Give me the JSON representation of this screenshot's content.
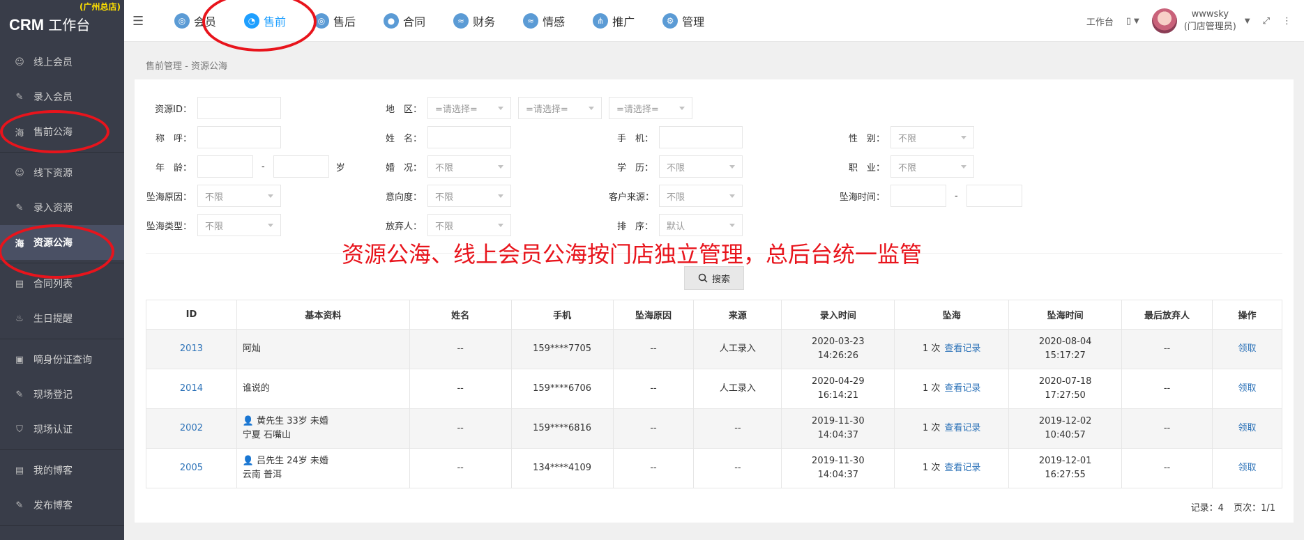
{
  "brand": {
    "title": "CRM",
    "subtitle": "工作台",
    "store": "(广州总店)"
  },
  "sidebar": {
    "groups": [
      [
        {
          "label": "线上会员",
          "icon": "user-icon"
        },
        {
          "label": "录入会员",
          "icon": "edit-icon"
        },
        {
          "label": "售前公海",
          "icon": "sea-icon"
        }
      ],
      [
        {
          "label": "线下资源",
          "icon": "user-group-icon"
        },
        {
          "label": "录入资源",
          "icon": "edit-icon"
        },
        {
          "label": "资源公海",
          "icon": "sea-icon",
          "active": true
        }
      ],
      [
        {
          "label": "合同列表",
          "icon": "list-icon"
        },
        {
          "label": "生日提醒",
          "icon": "cake-icon"
        }
      ],
      [
        {
          "label": "嘀身份证查询",
          "icon": "id-card-icon"
        },
        {
          "label": "现场登记",
          "icon": "edit-icon"
        },
        {
          "label": "现场认证",
          "icon": "shield-icon"
        }
      ],
      [
        {
          "label": "我的博客",
          "icon": "doc-icon"
        },
        {
          "label": "发布博客",
          "icon": "edit-icon"
        }
      ]
    ],
    "sea_glyph": "海"
  },
  "topnav": [
    {
      "label": "会员",
      "glyph": "◎"
    },
    {
      "label": "售前",
      "glyph": "◔",
      "active": true
    },
    {
      "label": "售后",
      "glyph": "◎"
    },
    {
      "label": "合同",
      "glyph": "●"
    },
    {
      "label": "财务",
      "glyph": "≈"
    },
    {
      "label": "情感",
      "glyph": "≈"
    },
    {
      "label": "推广",
      "glyph": "⋔"
    },
    {
      "label": "管理",
      "glyph": "⚙"
    }
  ],
  "topright": {
    "workbench": "工作台",
    "phone_icon": "▯",
    "username": "wwwsky",
    "role": "(门店管理员)",
    "fullscreen_icon": "⤢",
    "more_icon": "⋮"
  },
  "breadcrumb": "售前管理 - 资源公海",
  "filters": {
    "resource_id": "资源ID：",
    "region": "地　区：",
    "region_select": [
      "=请选择=",
      "=请选择=",
      "=请选择="
    ],
    "nickname": "称　呼：",
    "name": "姓　名：",
    "phone": "手　机：",
    "gender": "性　别：",
    "gender_value": "不限",
    "age": "年　龄：",
    "age_unit": "岁",
    "marriage": "婚　况：",
    "marriage_value": "不限",
    "education": "学　历：",
    "education_value": "不限",
    "job": "职　业：",
    "job_value": "不限",
    "reason": "坠海原因：",
    "reason_value": "不限",
    "intent": "意向度：",
    "intent_value": "不限",
    "source": "客户来源：",
    "source_value": "不限",
    "fall_time": "坠海时间：",
    "fall_type": "坠海类型：",
    "fall_type_value": "不限",
    "abandoner": "放弃人：",
    "abandoner_value": "不限",
    "sort": "排　序：",
    "sort_value": "默认",
    "dash": "-"
  },
  "annotation": "资源公海、线上会员公海按门店独立管理，总后台统一监管",
  "search_button": "搜索",
  "table": {
    "headers": [
      "ID",
      "基本资料",
      "姓名",
      "手机",
      "坠海原因",
      "来源",
      "录入时间",
      "坠海",
      "坠海时间",
      "最后放弃人",
      "操作"
    ],
    "rows": [
      {
        "id": "2013",
        "basic1": "阿灿",
        "basic2": "",
        "person": false,
        "name": "--",
        "phone": "159****7705",
        "reason": "--",
        "source": "人工录入",
        "entry_date": "2020-03-23",
        "entry_time": "14:26:26",
        "fall_count": "1 次",
        "fall_link": "查看记录",
        "fall_date": "2020-08-04",
        "fall_time": "15:17:27",
        "last": "--",
        "action": "领取"
      },
      {
        "id": "2014",
        "basic1": "谁说的",
        "basic2": "",
        "person": false,
        "name": "--",
        "phone": "159****6706",
        "reason": "--",
        "source": "人工录入",
        "entry_date": "2020-04-29",
        "entry_time": "16:14:21",
        "fall_count": "1 次",
        "fall_link": "查看记录",
        "fall_date": "2020-07-18",
        "fall_time": "17:27:50",
        "last": "--",
        "action": "领取"
      },
      {
        "id": "2002",
        "basic1": "黄先生 33岁 未婚",
        "basic2": "宁夏 石嘴山",
        "person": true,
        "name": "--",
        "phone": "159****6816",
        "reason": "--",
        "source": "--",
        "entry_date": "2019-11-30",
        "entry_time": "14:04:37",
        "fall_count": "1 次",
        "fall_link": "查看记录",
        "fall_date": "2019-12-02",
        "fall_time": "10:40:57",
        "last": "--",
        "action": "领取"
      },
      {
        "id": "2005",
        "basic1": "吕先生 24岁 未婚",
        "basic2": "云南 普洱",
        "person": true,
        "name": "--",
        "phone": "134****4109",
        "reason": "--",
        "source": "--",
        "entry_date": "2019-11-30",
        "entry_time": "14:04:37",
        "fall_count": "1 次",
        "fall_link": "查看记录",
        "fall_date": "2019-12-01",
        "fall_time": "16:27:55",
        "last": "--",
        "action": "领取"
      }
    ]
  },
  "footer": {
    "records_label": "记录：",
    "records": "4",
    "pages_label": "页次：",
    "pages": "1/1"
  },
  "colors": {
    "accent": "#1e9fff",
    "annotation": "#e8141c",
    "sidebar": "#393d49",
    "link": "#2c72b8"
  }
}
